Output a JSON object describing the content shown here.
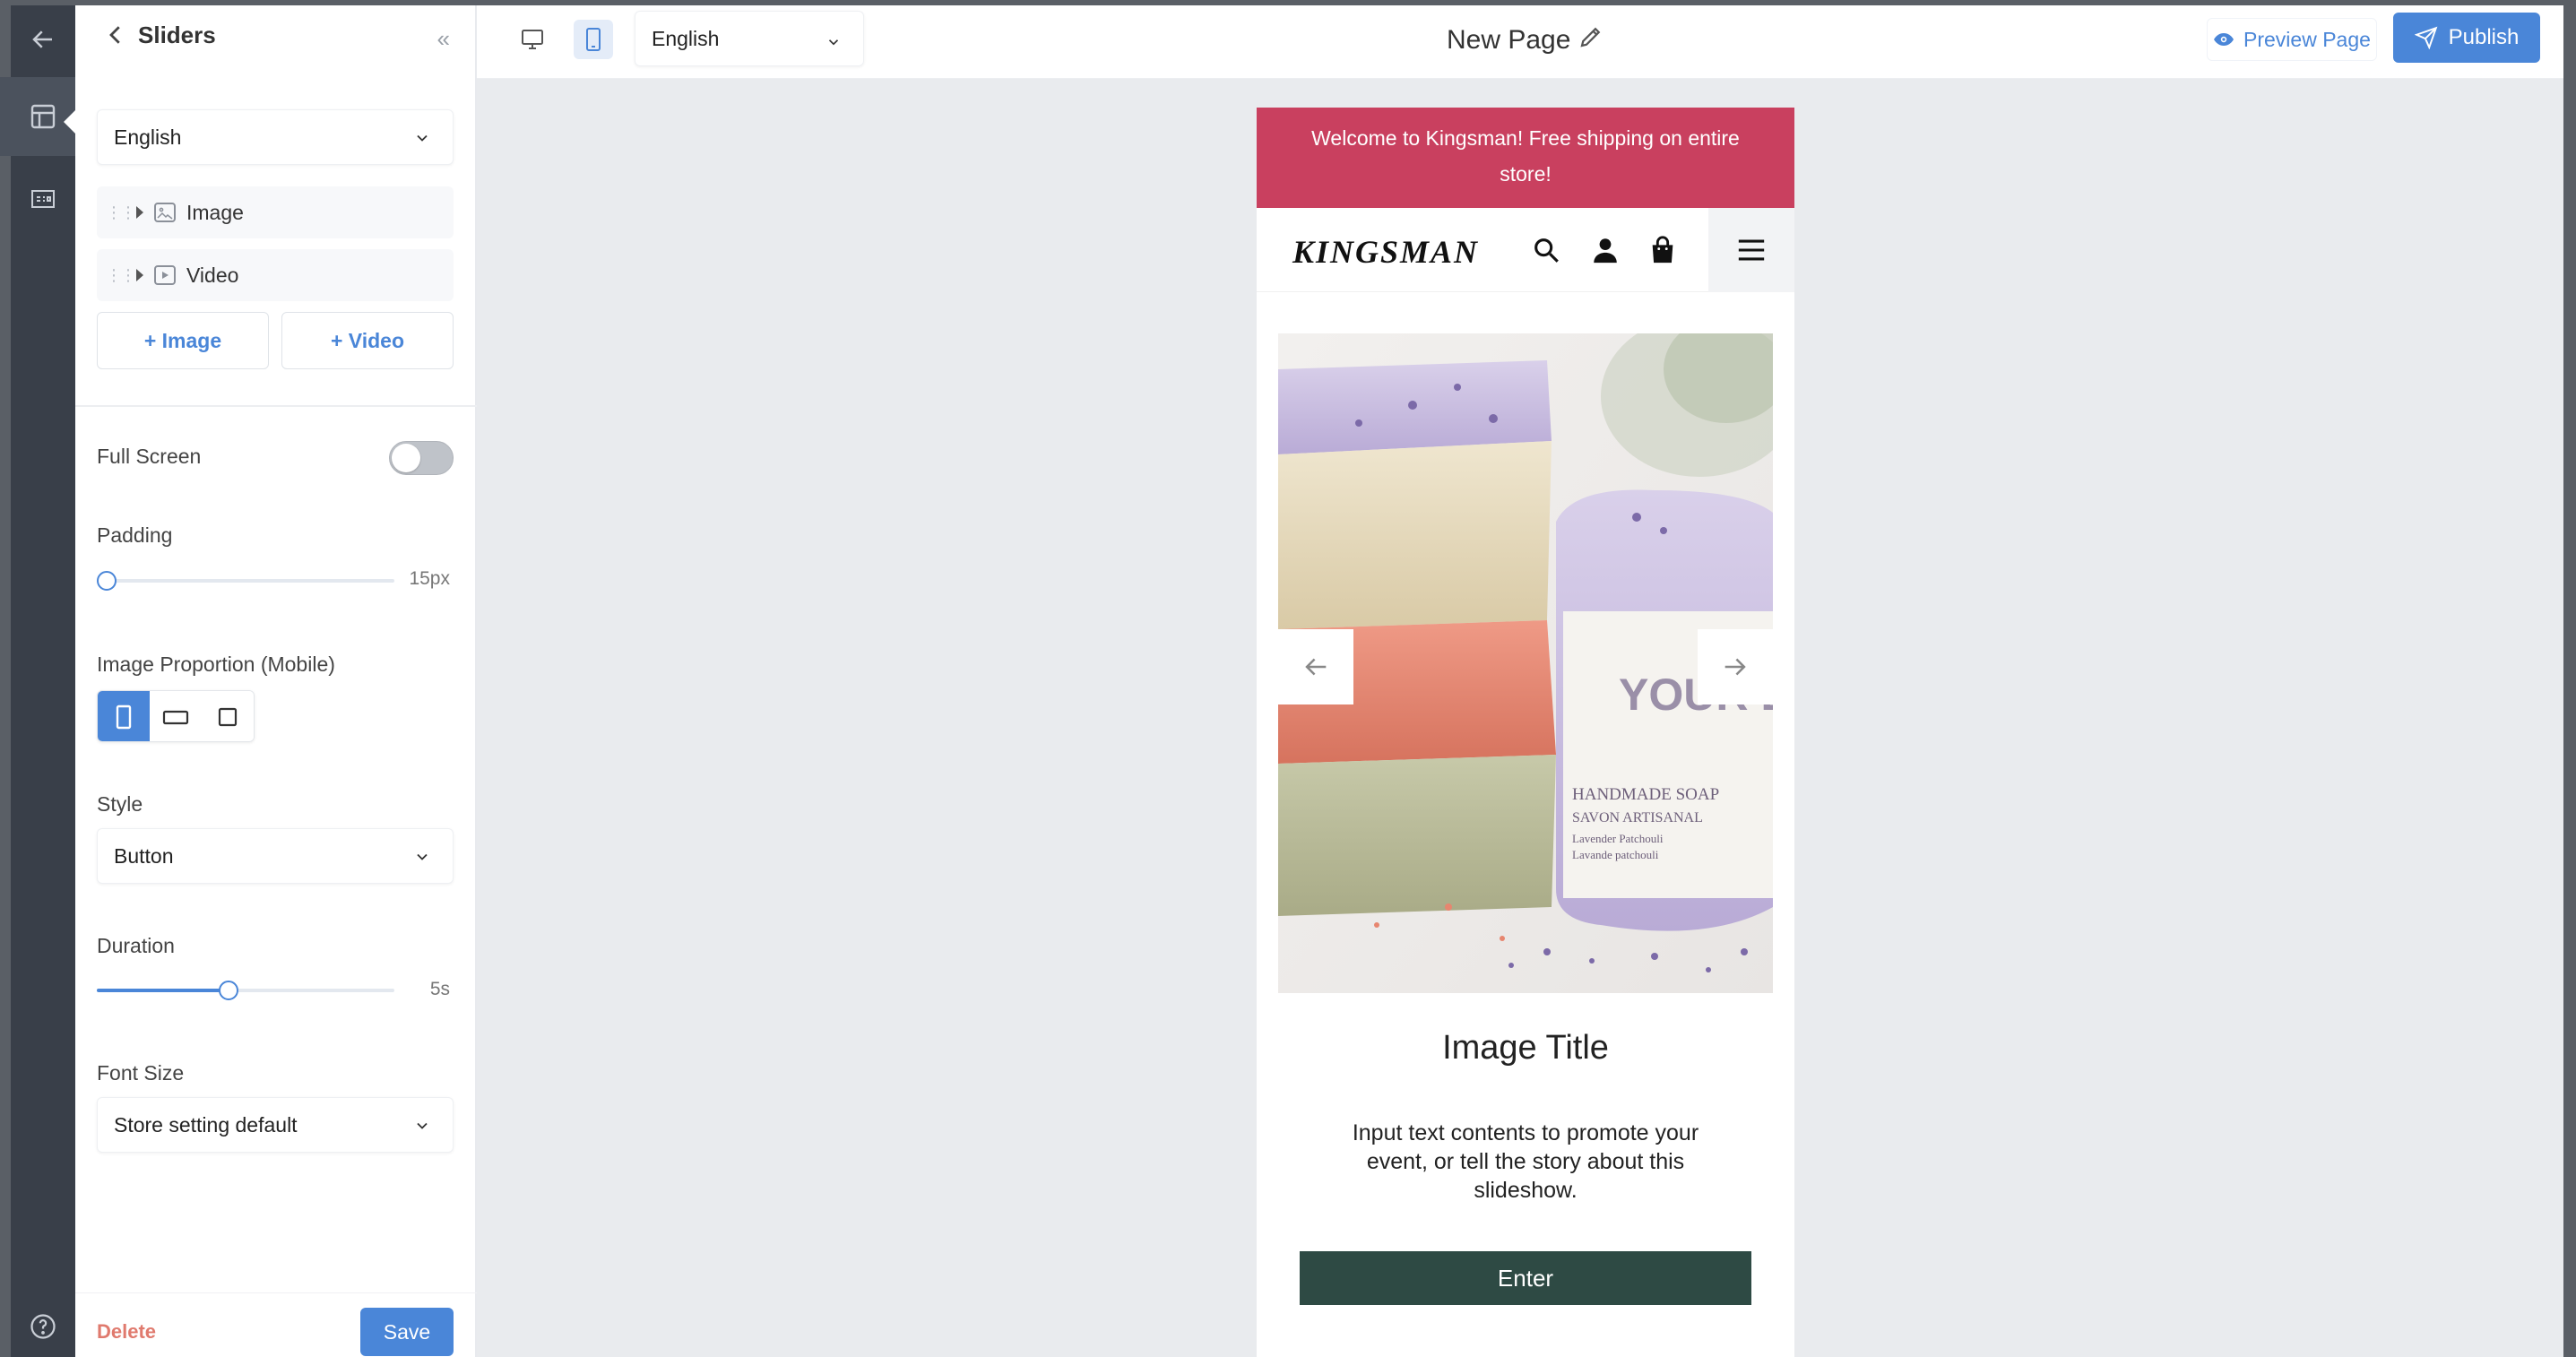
{
  "sidebar": {
    "title": "Sliders",
    "language": "English",
    "tree": [
      {
        "label": "Image"
      },
      {
        "label": "Video"
      }
    ],
    "add_image": "+ Image",
    "add_video": "+ Video",
    "full_screen_label": "Full Screen",
    "full_screen_on": false,
    "padding_label": "Padding",
    "padding_value": "15px",
    "padding_fraction": 0.0,
    "proportion_label": "Image Proportion (Mobile)",
    "proportion_selected": "portrait",
    "style_label": "Style",
    "style_value": "Button",
    "duration_label": "Duration",
    "duration_value": "5s",
    "duration_fraction": 0.44,
    "font_size_label": "Font Size",
    "font_size_value": "Store setting default",
    "delete_label": "Delete",
    "save_label": "Save"
  },
  "topbar": {
    "language": "English",
    "page_title": "New Page",
    "preview_label": "Preview Page",
    "publish_label": "Publish",
    "device_selected": "mobile"
  },
  "preview": {
    "banner": "Welcome to Kingsman! Free shipping on entire store!",
    "logo": "KINGSMAN",
    "image_title": "Image Title",
    "image_desc": "Input text contents to promote your event, or tell the story about this slideshow.",
    "button": "Enter",
    "soap_logo": "YOUR LOGO",
    "soap_label_1": "HANDMADE SOAP",
    "soap_label_2": "SAVON ARTISANAL",
    "soap_label_3": "Lavender Patchouli",
    "soap_label_4": "Lavande patchouli"
  },
  "colors": {
    "accent": "#4a86d8",
    "banner": "#c9405f",
    "enter_button": "#2e4a44",
    "delete": "#e07a6e"
  }
}
